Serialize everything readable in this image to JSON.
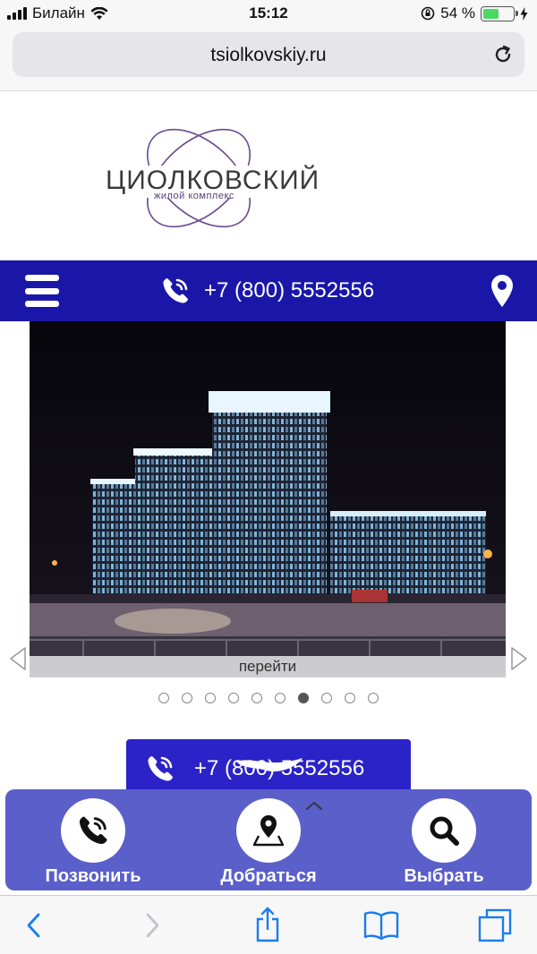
{
  "status_bar": {
    "carrier": "Билайн",
    "time": "15:12",
    "battery": "54 %",
    "battery_level": 0.54
  },
  "url_bar": {
    "url": "tsiolkovskiy.ru"
  },
  "logo": {
    "title": "ЦИОЛКОВСКИЙ",
    "subtitle": "жилой комплекс"
  },
  "header": {
    "phone": "+7 (800) 5552556"
  },
  "slider": {
    "caption": "перейти",
    "total_slides": 10,
    "active_index": 6
  },
  "cta": {
    "phone": "+7 (800) 5552556"
  },
  "actions": [
    {
      "label": "Позвонить",
      "icon": "phone-icon"
    },
    {
      "label": "Добраться",
      "icon": "map-pin-icon"
    },
    {
      "label": "Выбрать",
      "icon": "search-icon"
    }
  ],
  "colors": {
    "brand_blue": "#1a17a8",
    "button_blue": "#2b23c8",
    "panel_blue": "#5a5fc9",
    "ios_blue": "#1a7cf0"
  }
}
